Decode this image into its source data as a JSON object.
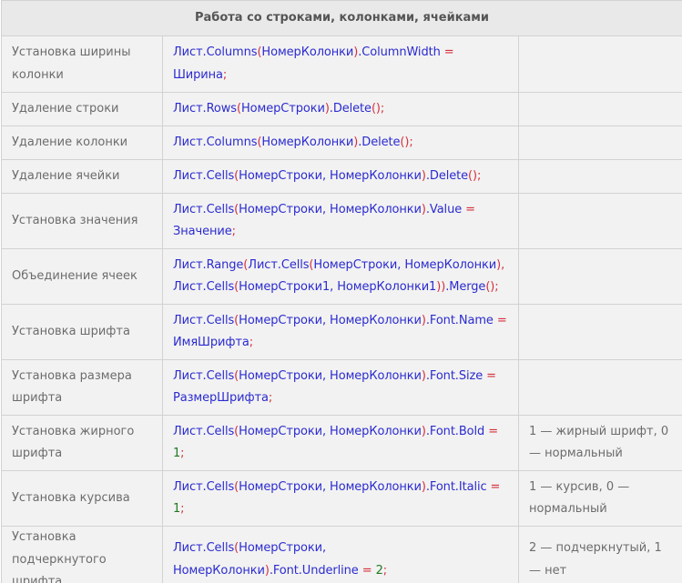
{
  "table": {
    "title": "Работа со строками, колонками, ячейками",
    "rows": [
      {
        "name": "Установка ширины колонки",
        "code": [
          [
            "Лист.Columns",
            "c"
          ],
          [
            "(",
            "p"
          ],
          [
            "НомерКолонки",
            "c"
          ],
          [
            ")",
            "p"
          ],
          [
            ".ColumnWidth ",
            "c"
          ],
          [
            "=",
            "op"
          ],
          [
            " Ширина",
            "c"
          ],
          [
            ";",
            "p"
          ]
        ],
        "note": ""
      },
      {
        "name": "Удаление строки",
        "code": [
          [
            "Лист.Rows",
            "c"
          ],
          [
            "(",
            "p"
          ],
          [
            "НомерСтроки",
            "c"
          ],
          [
            ")",
            "p"
          ],
          [
            ".Delete",
            "c"
          ],
          [
            "();",
            "p"
          ]
        ],
        "note": ""
      },
      {
        "name": "Удаление колонки",
        "code": [
          [
            "Лист.Columns",
            "c"
          ],
          [
            "(",
            "p"
          ],
          [
            "НомерКолонки",
            "c"
          ],
          [
            ")",
            "p"
          ],
          [
            ".Delete",
            "c"
          ],
          [
            "();",
            "p"
          ]
        ],
        "note": ""
      },
      {
        "name": "Удаление ячейки",
        "code": [
          [
            "Лист.Cells",
            "c"
          ],
          [
            "(",
            "p"
          ],
          [
            "НомерСтроки, НомерКолонки",
            "c"
          ],
          [
            ")",
            "p"
          ],
          [
            ".Delete",
            "c"
          ],
          [
            "();",
            "p"
          ]
        ],
        "note": ""
      },
      {
        "name": "Установка значения",
        "code": [
          [
            "Лист.Cells",
            "c"
          ],
          [
            "(",
            "p"
          ],
          [
            "НомерСтроки, НомерКолонки",
            "c"
          ],
          [
            ")",
            "p"
          ],
          [
            ".Value ",
            "c"
          ],
          [
            "=",
            "op"
          ],
          [
            " Значение",
            "c"
          ],
          [
            ";",
            "p"
          ]
        ],
        "note": ""
      },
      {
        "name": "Объединение ячеек",
        "code": [
          [
            "Лист.Range",
            "c"
          ],
          [
            "(",
            "p"
          ],
          [
            "Лист.Cells",
            "c"
          ],
          [
            "(",
            "p"
          ],
          [
            "НомерСтроки, НомерКолонки",
            "c"
          ],
          [
            "),",
            "p"
          ],
          [
            " Лист.Cells",
            "c"
          ],
          [
            "(",
            "p"
          ],
          [
            "НомерСтроки1, НомерКолонки1",
            "c"
          ],
          [
            "))",
            "p"
          ],
          [
            ".Merge",
            "c"
          ],
          [
            "();",
            "p"
          ]
        ],
        "note": ""
      },
      {
        "name": "Установка шрифта",
        "code": [
          [
            "Лист.Cells",
            "c"
          ],
          [
            "(",
            "p"
          ],
          [
            "НомерСтроки, НомерКолонки",
            "c"
          ],
          [
            ")",
            "p"
          ],
          [
            ".Font.Name ",
            "c"
          ],
          [
            "=",
            "op"
          ],
          [
            " ИмяШрифта",
            "c"
          ],
          [
            ";",
            "p"
          ]
        ],
        "note": ""
      },
      {
        "name": "Установка размера шрифта",
        "code": [
          [
            "Лист.Cells",
            "c"
          ],
          [
            "(",
            "p"
          ],
          [
            "НомерСтроки, НомерКолонки",
            "c"
          ],
          [
            ")",
            "p"
          ],
          [
            ".Font.Size ",
            "c"
          ],
          [
            "=",
            "op"
          ],
          [
            " РазмерШрифта",
            "c"
          ],
          [
            ";",
            "p"
          ]
        ],
        "note": ""
      },
      {
        "name": "Установка жирного шрифта",
        "code": [
          [
            "Лист.Cells",
            "c"
          ],
          [
            "(",
            "p"
          ],
          [
            "НомерСтроки, НомерКолонки",
            "c"
          ],
          [
            ")",
            "p"
          ],
          [
            ".Font.Bold ",
            "c"
          ],
          [
            "=",
            "op"
          ],
          [
            " ",
            "c"
          ],
          [
            "1",
            "num"
          ],
          [
            ";",
            "p"
          ]
        ],
        "note": "1 — жирный шрифт, 0 — нормальный"
      },
      {
        "name": "Установка курсива",
        "code": [
          [
            "Лист.Cells",
            "c"
          ],
          [
            "(",
            "p"
          ],
          [
            "НомерСтроки, НомерКолонки",
            "c"
          ],
          [
            ")",
            "p"
          ],
          [
            ".Font.Italic ",
            "c"
          ],
          [
            "=",
            "op"
          ],
          [
            " ",
            "c"
          ],
          [
            "1",
            "num"
          ],
          [
            ";",
            "p"
          ]
        ],
        "note": "1 — курсив, 0 — нормальный"
      },
      {
        "name": "Установка подчеркнутого шрифта",
        "code": [
          [
            "Лист.Cells",
            "c"
          ],
          [
            "(",
            "p"
          ],
          [
            "НомерСтроки, НомерКолонки",
            "c"
          ],
          [
            ")",
            "p"
          ],
          [
            ".Font.Underline ",
            "c"
          ],
          [
            "=",
            "op"
          ],
          [
            " ",
            "c"
          ],
          [
            "2",
            "num"
          ],
          [
            ";",
            "p"
          ]
        ],
        "note": "2 — подчеркнутый, 1 — нет"
      }
    ]
  },
  "colors": {
    "code_text": "#2b2bd0",
    "punctuation": "#d5303e",
    "number": "#1f7a1f",
    "label_text": "#6c6c6c",
    "header_bg": "#e9e9e9",
    "row_bg": "#f2f2f2",
    "border": "#d2d2d2"
  }
}
